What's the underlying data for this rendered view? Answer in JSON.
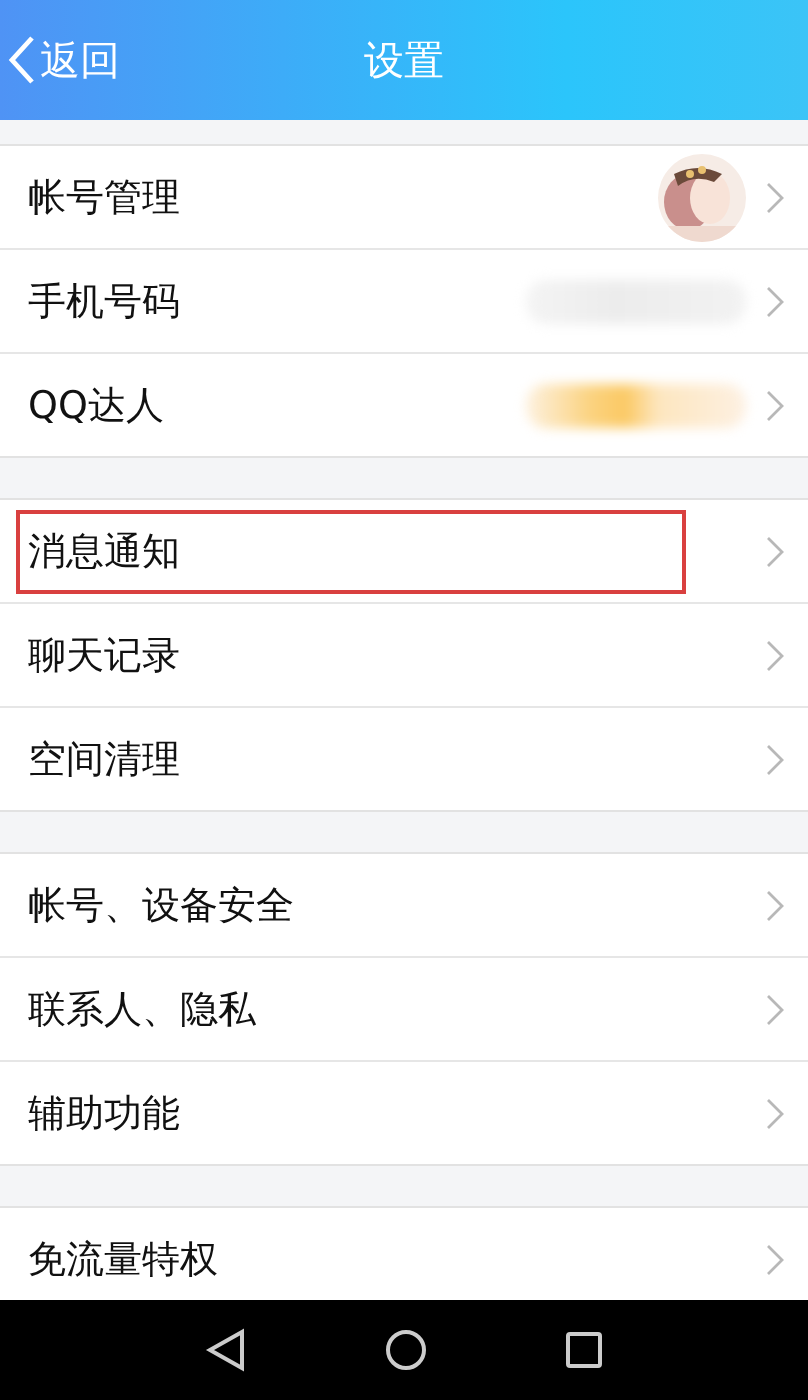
{
  "header": {
    "back": "返回",
    "title": "设置"
  },
  "groups": [
    {
      "items": [
        {
          "label": "帐号管理",
          "kind": "avatar",
          "highlighted": false
        },
        {
          "label": "手机号码",
          "kind": "phone",
          "highlighted": false
        },
        {
          "label": "QQ达人",
          "kind": "badge",
          "highlighted": false
        }
      ]
    },
    {
      "items": [
        {
          "label": "消息通知",
          "kind": "plain",
          "highlighted": true
        },
        {
          "label": "聊天记录",
          "kind": "plain",
          "highlighted": false
        },
        {
          "label": "空间清理",
          "kind": "plain",
          "highlighted": false
        }
      ]
    },
    {
      "items": [
        {
          "label": "帐号、设备安全",
          "kind": "plain",
          "highlighted": false
        },
        {
          "label": "联系人、隐私",
          "kind": "plain",
          "highlighted": false
        },
        {
          "label": "辅助功能",
          "kind": "plain",
          "highlighted": false
        }
      ]
    },
    {
      "items": [
        {
          "label": "免流量特权",
          "kind": "plain",
          "highlighted": false
        }
      ]
    }
  ]
}
